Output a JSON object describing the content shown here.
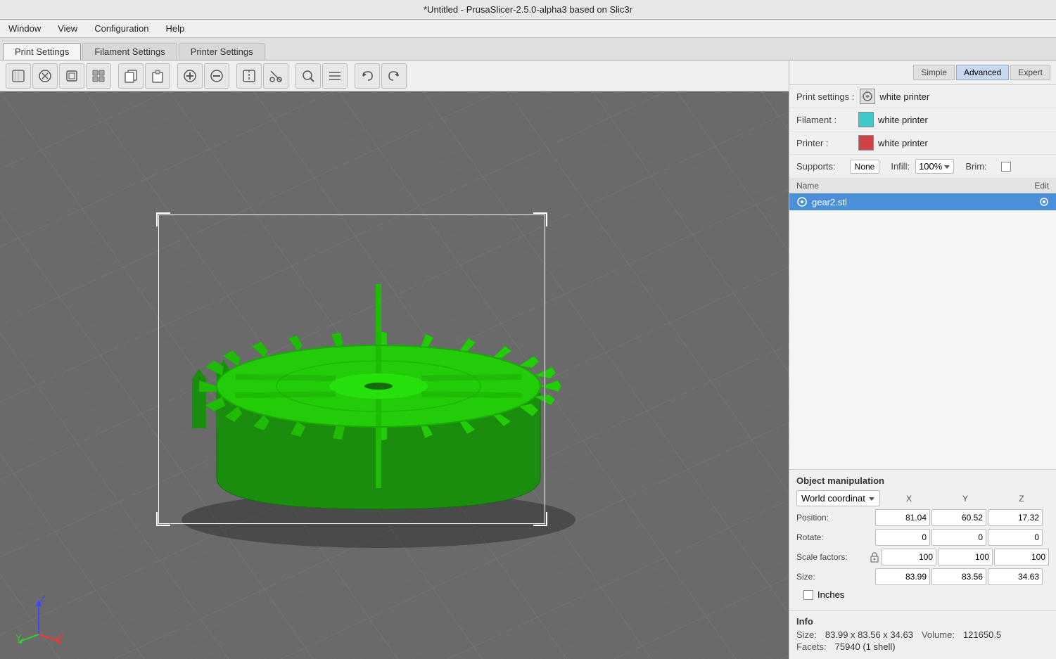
{
  "titlebar": {
    "title": "*Untitled - PrusaSlicer-2.5.0-alpha3 based on Slic3r"
  },
  "menubar": {
    "items": [
      {
        "id": "window",
        "label": "Window"
      },
      {
        "id": "view",
        "label": "View"
      },
      {
        "id": "configuration",
        "label": "Configuration"
      },
      {
        "id": "help",
        "label": "Help"
      }
    ]
  },
  "tabbar": {
    "tabs": [
      {
        "id": "print-settings",
        "label": "Print Settings",
        "active": true
      },
      {
        "id": "filament-settings",
        "label": "Filament Settings",
        "active": false
      },
      {
        "id": "printer-settings",
        "label": "Printer Settings",
        "active": false
      }
    ]
  },
  "toolbar": {
    "buttons": [
      {
        "id": "add",
        "icon": "⊞",
        "tooltip": "Add"
      },
      {
        "id": "delete",
        "icon": "⊟",
        "tooltip": "Delete"
      },
      {
        "id": "delete-all",
        "icon": "▣",
        "tooltip": "Delete All"
      },
      {
        "id": "arrange",
        "icon": "⊡",
        "tooltip": "Arrange"
      },
      {
        "id": "copy",
        "icon": "⧉",
        "tooltip": "Copy"
      },
      {
        "id": "paste",
        "icon": "📋",
        "tooltip": "Paste"
      },
      {
        "id": "more",
        "icon": "⊕",
        "tooltip": "More"
      },
      {
        "id": "less",
        "icon": "⊖",
        "tooltip": "Less"
      },
      {
        "id": "split",
        "icon": "⧈",
        "tooltip": "Split"
      },
      {
        "id": "cut",
        "icon": "⊗",
        "tooltip": "Cut"
      },
      {
        "id": "search",
        "icon": "🔍",
        "tooltip": "Search"
      },
      {
        "id": "layer",
        "icon": "☰",
        "tooltip": "Layers"
      },
      {
        "id": "undo",
        "icon": "↩",
        "tooltip": "Undo"
      },
      {
        "id": "redo",
        "icon": "↪",
        "tooltip": "Redo"
      }
    ]
  },
  "mode_buttons": {
    "simple": "Simple",
    "advanced": "Advanced",
    "expert": "Expert"
  },
  "right_panel": {
    "print_settings_label": "Print settings :",
    "print_settings_value": "white printer",
    "filament_label": "Filament :",
    "filament_value": "white printer",
    "filament_color": "#3ec8c8",
    "printer_label": "Printer :",
    "printer_value": "white printer",
    "printer_color": "#cc4444",
    "supports_label": "Supports:",
    "supports_value": "None",
    "infill_label": "Infill:",
    "infill_value": "100%",
    "brim_label": "Brim:",
    "brim_checked": false,
    "object_list": {
      "col_name": "Name",
      "col_edit": "Edit",
      "rows": [
        {
          "id": "gear2",
          "name": "gear2.stl"
        }
      ]
    }
  },
  "object_manipulation": {
    "title": "Object manipulation",
    "coord_system": "World coordinat",
    "labels": {
      "x": "X",
      "y": "Y",
      "z": "Z"
    },
    "position": {
      "label": "Position:",
      "x": "81.04",
      "y": "60.52",
      "z": "17.32"
    },
    "rotate": {
      "label": "Rotate:",
      "x": "0",
      "y": "0",
      "z": "0"
    },
    "scale_factors": {
      "label": "Scale factors:",
      "x": "100",
      "y": "100",
      "z": "100"
    },
    "size": {
      "label": "Size:",
      "x": "83.99",
      "y": "83.56",
      "z": "34.63"
    },
    "inches_label": "Inches",
    "inches_checked": false
  },
  "info": {
    "title": "Info",
    "size_label": "Size:",
    "size_value": "83.99 x 83.56 x 34.63",
    "volume_label": "Volume:",
    "volume_value": "121650.5",
    "facets_label": "Facets:",
    "facets_value": "75940 (1 shell)"
  }
}
